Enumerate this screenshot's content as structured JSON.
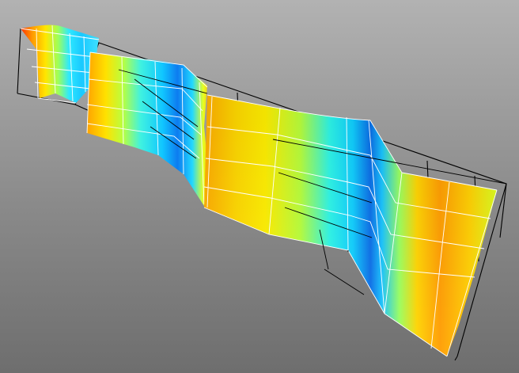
{
  "viewport": {
    "background_top": "#b2b2b2",
    "background_bottom": "#6e6e6e"
  },
  "surface": {
    "type": "folded-ribbon-surface",
    "colormap": "jet",
    "mesh_color": "#ffffff",
    "bounding_box_color": "#000000",
    "panels": 3
  }
}
